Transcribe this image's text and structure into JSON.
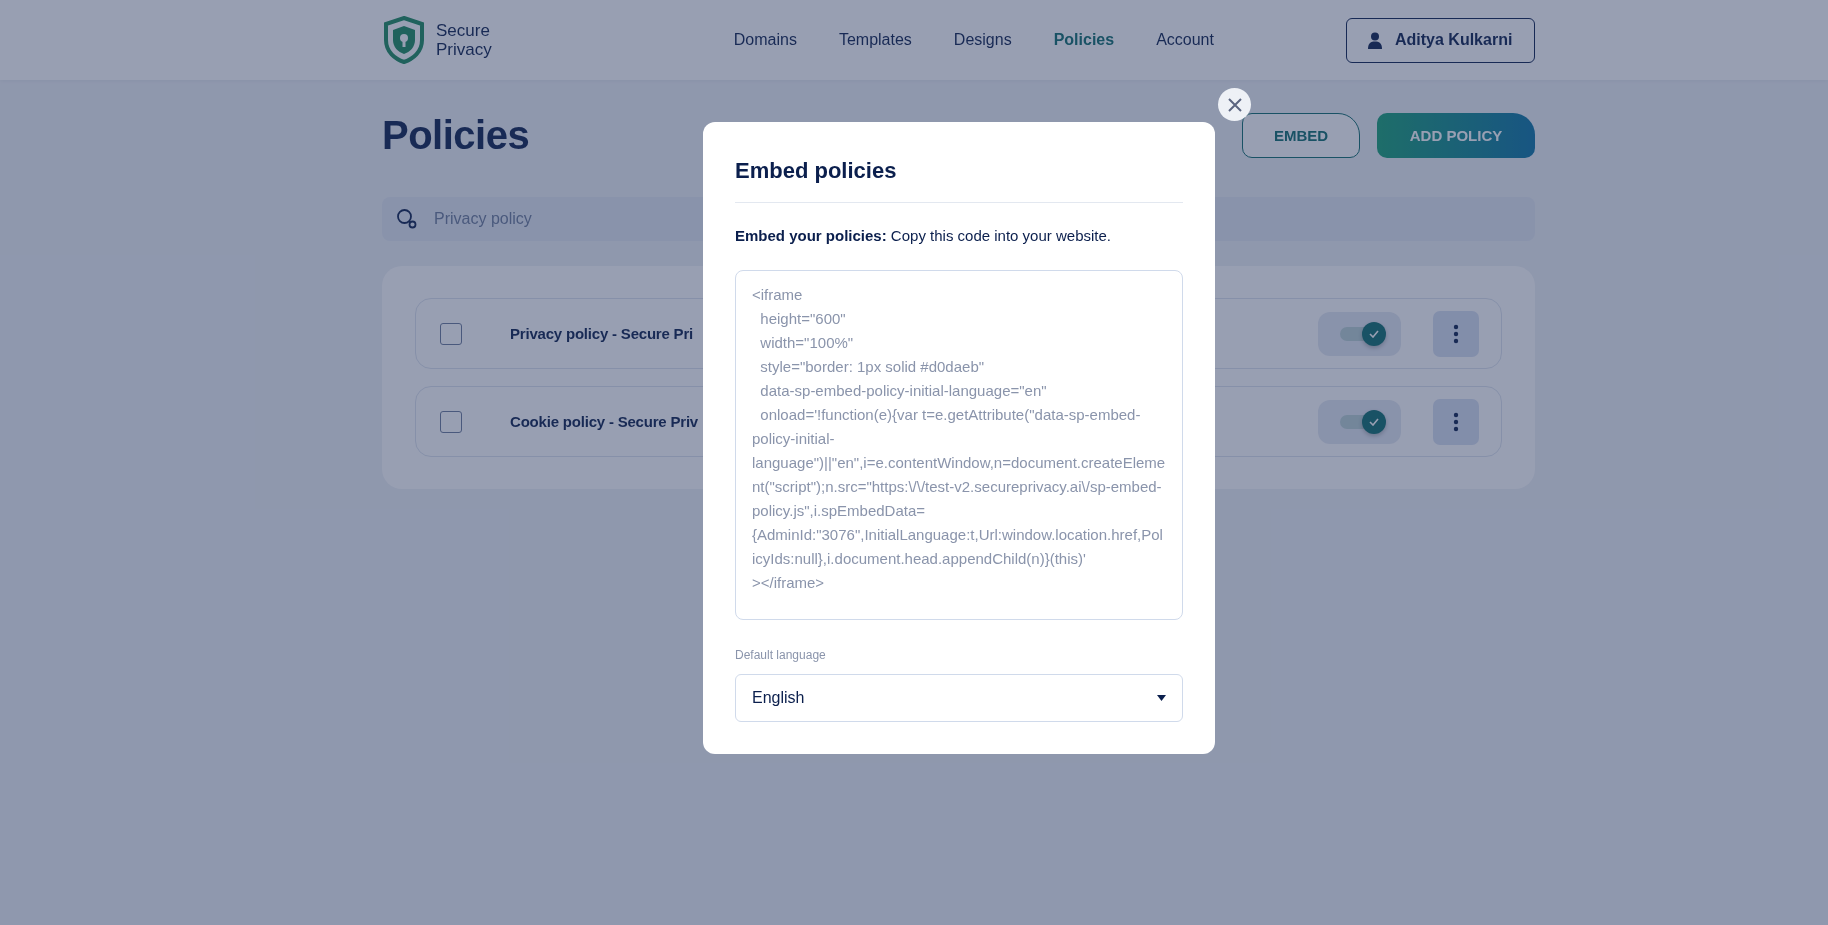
{
  "header": {
    "logo": {
      "line_1": "Secure",
      "line_2": "Privacy"
    },
    "nav": [
      {
        "label": "Domains",
        "selected": false
      },
      {
        "label": "Templates",
        "selected": false
      },
      {
        "label": "Designs",
        "selected": false
      },
      {
        "label": "Policies",
        "selected": true
      },
      {
        "label": "Account",
        "selected": false
      }
    ],
    "user": "Aditya Kulkarni"
  },
  "page": {
    "title": "Policies",
    "buttons": [
      {
        "label": "EMBED",
        "kind": "outline"
      },
      {
        "label": "ADD POLICY",
        "kind": "primary"
      }
    ],
    "search": {
      "placeholder": "Privacy policy"
    },
    "policies": [
      {
        "name": "Privacy policy - Secure Pri",
        "checked": false,
        "on": true
      },
      {
        "name": "Cookie policy - Secure Priv",
        "checked": false,
        "on": true
      }
    ]
  },
  "modal": {
    "title": "Embed policies",
    "intro": "**Embed your policies:** Copy this code into your website.",
    "code": "<iframe\n  height=\"600\"\n  width=\"100%\"\n  style=\"border: 1px solid #d0daeb\"\n  data-sp-embed-policy-initial-language=\"en\"\n  onload='!function(e){var t=e.getAttribute(\"data-sp-embed-policy-initial-language\")||\"en\",i=e.contentWindow,n=document.createElement(\"script\");n.src=\"https:\\/\\/test-v2.secureprivacy.ai\\/sp-embed-policy.js\",i.spEmbedData={AdminId:\"3076\",InitialLanguage:t,Url:window.location.href,PolicyIds:null},i.document.head.appendChild(n)}(this)'\n></iframe>",
    "language_label": "Default language",
    "language": "English"
  }
}
